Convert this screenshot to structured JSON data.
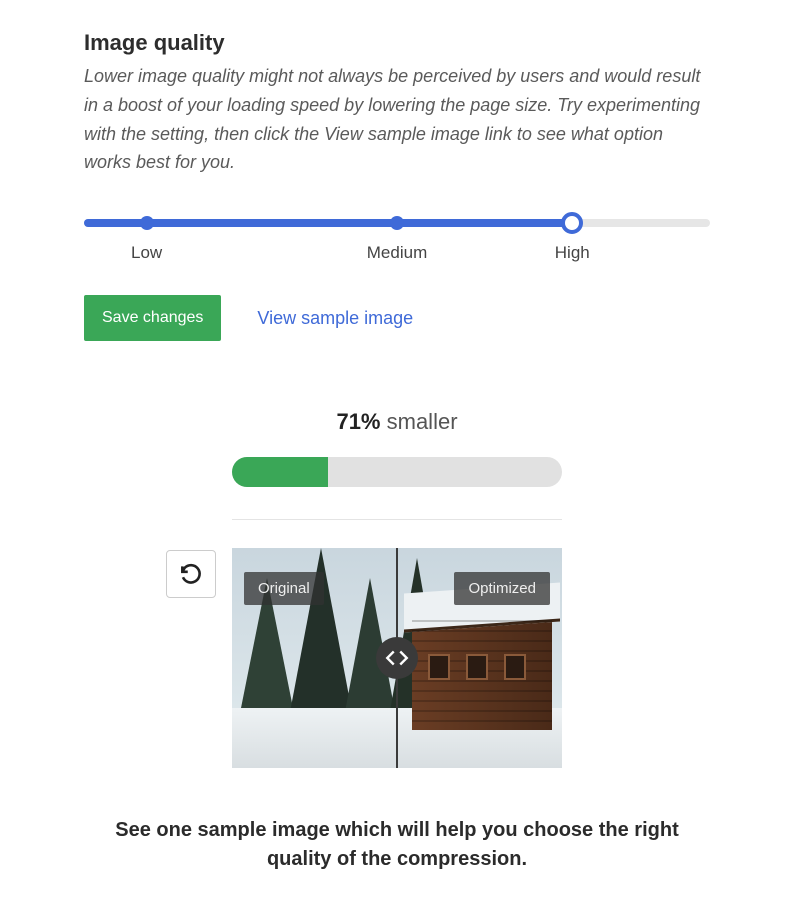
{
  "heading": "Image quality",
  "description": "Lower image quality might not always be perceived by users and would result in a boost of your loading speed by lowering the page size. Try experimenting with the setting, then click the View sample image link to see what option works best for you.",
  "slider": {
    "labels": {
      "low": "Low",
      "medium": "Medium",
      "high": "High"
    },
    "value": "High"
  },
  "buttons": {
    "save": "Save changes",
    "view_sample": "View sample image"
  },
  "result": {
    "percent": "71%",
    "suffix": "smaller",
    "bar_remaining_pct": 29
  },
  "compare": {
    "original_label": "Original",
    "optimized_label": "Optimized"
  },
  "footer": "See one sample image which will help you choose the right quality of the compression."
}
